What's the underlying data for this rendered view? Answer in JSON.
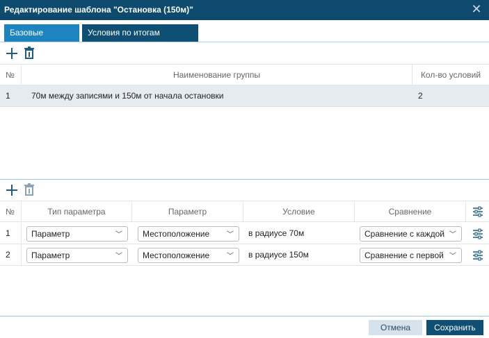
{
  "dialog": {
    "title": "Редактирование шаблона \"Остановка (150м)\""
  },
  "tabs": [
    {
      "label": "Базовые условия"
    },
    {
      "label": "Условия по итогам события"
    }
  ],
  "groups_table": {
    "headers": [
      "№",
      "Наименование группы",
      "Кол-во условий"
    ],
    "rows": [
      {
        "num": "1",
        "name": "70м между записями и 150м от начала остановки",
        "count": "2"
      }
    ]
  },
  "params_table": {
    "headers": [
      "№",
      "Тип параметра",
      "Параметр",
      "Условие",
      "Сравнение"
    ],
    "rows": [
      {
        "num": "1",
        "type": "Параметр",
        "param": "Местоположение",
        "condition": "в радиусе 70м",
        "comparison": "Сравнение с каждой"
      },
      {
        "num": "2",
        "type": "Параметр",
        "param": "Местоположение",
        "condition": "в радиусе 150м",
        "comparison": "Сравнение с первой"
      }
    ]
  },
  "footer": {
    "cancel_label": "Отмена",
    "save_label": "Сохранить"
  },
  "colors": {
    "title_bar": "#0d4a6e",
    "tab_active": "#1e84c0",
    "primary_button": "#0f4f73"
  }
}
